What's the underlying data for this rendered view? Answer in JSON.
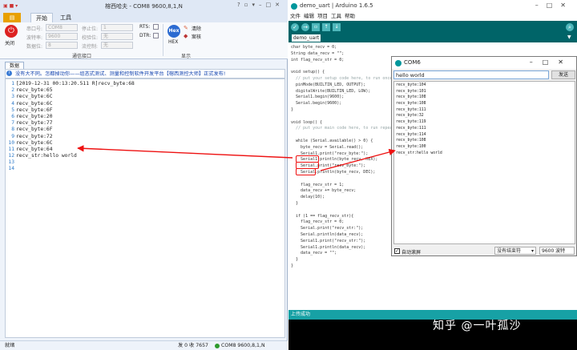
{
  "left_app": {
    "title": "榕西哈夫 - COM8  9600,8,1,N",
    "tabs": [
      "开始",
      "工具"
    ],
    "close_label": "关闭",
    "port_labels": [
      "串口号:",
      "波特率:",
      "数据位:"
    ],
    "port_values": [
      "COM8",
      "9600",
      "8"
    ],
    "stop_labels": [
      "停止位:",
      "校验位:",
      "流控制:"
    ],
    "stop_values": [
      "1",
      "无",
      "无"
    ],
    "rts_label": "RTS:",
    "dtr_label": "DTR:",
    "hex_label": "HEX",
    "hex_badge": "Hex",
    "clear_label": "清除",
    "save_label": "案核",
    "group_serial": "通信接口",
    "group_display": "显示",
    "doc_tab": "数据",
    "notice": "没有大不同。怎都掉动你——组态式测试、测量和控制软件开发平台【榕西测控大师】正式发布!",
    "terminal": [
      {
        "n": "1",
        "t": "[2019-12-31 00:13:20.511 R]recv_byte:68"
      },
      {
        "n": "2",
        "t": "recv_byte:65"
      },
      {
        "n": "3",
        "t": "recv_byte:6C"
      },
      {
        "n": "4",
        "t": "recv_byte:6C"
      },
      {
        "n": "5",
        "t": "recv_byte:6F"
      },
      {
        "n": "6",
        "t": "recv_byte:20"
      },
      {
        "n": "7",
        "t": "recv_byte:77"
      },
      {
        "n": "8",
        "t": "recv_byte:6F"
      },
      {
        "n": "9",
        "t": "recv_byte:72"
      },
      {
        "n": "10",
        "t": "recv_byte:6C"
      },
      {
        "n": "11",
        "t": "recv_byte:64"
      },
      {
        "n": "12",
        "t": "recv_str:hello world"
      },
      {
        "n": "13",
        "t": ""
      },
      {
        "n": "14",
        "t": ""
      }
    ],
    "status_left": "就绪",
    "status_counts": "发 0  收 7657",
    "status_port": "COM8  9600,8,1,N"
  },
  "arduino": {
    "title": "demo_uart | Arduino 1.6.5",
    "menu": [
      "文件",
      "编辑",
      "项目",
      "工具",
      "帮助"
    ],
    "tab": "demo_uart",
    "code": [
      "char byte_recv = 0;",
      "String data_recv = \"\";",
      "int flag_recv_str = 0;",
      "",
      "void setup() {",
      "  // put your setup code here, to run once:",
      "  pinMode(BUILTIN_LED, OUTPUT);",
      "  digitalWrite(BUILTIN_LED, LOW);",
      "  Serial1.begin(9600);",
      "  Serial.begin(9600);",
      "}",
      "",
      "void loop() {",
      "  // put your main code here, to run repeatedly:",
      "",
      "  while (Serial.available() > 0) {",
      "    byte_recv = Serial.read();",
      "    Serial1.print(\"recv_byte:\");",
      "    Serial1.println(byte_recv, HEX);",
      "    Serial.print(\"recv_byte:\");",
      "    Serial.println(byte_recv, DEC);",
      "",
      "    flag_recv_str = 1;",
      "    data_recv += byte_recv;",
      "    delay(10);",
      "  }",
      "",
      "  if (1 == flag_recv_str){",
      "    flag_recv_str = 0;",
      "    Serial.print(\"recv_str:\");",
      "    Serial.println(data_recv);",
      "    Serial1.print(\"recv_str:\");",
      "    Serial1.println(data_recv);",
      "    data_recv = \"\";",
      "  }",
      "}"
    ],
    "status": "上传成功"
  },
  "monitor": {
    "title": "COM6",
    "input": "hello world",
    "send_label": "发送",
    "output": [
      "recv_byte:104",
      "recv_byte:101",
      "recv_byte:108",
      "recv_byte:108",
      "recv_byte:111",
      "recv_byte:32",
      "recv_byte:119",
      "recv_byte:111",
      "recv_byte:114",
      "recv_byte:108",
      "recv_byte:100",
      "recv_str:hello world"
    ],
    "autoscroll_label": "自动滚屏",
    "line_ending": "没有结束符",
    "baud": "9600 波特"
  },
  "watermark": "知乎 @一叶孤沙",
  "colors": {
    "arduino_teal": "#006468",
    "arrow_red": "#e11",
    "link_blue": "#1646b0"
  }
}
